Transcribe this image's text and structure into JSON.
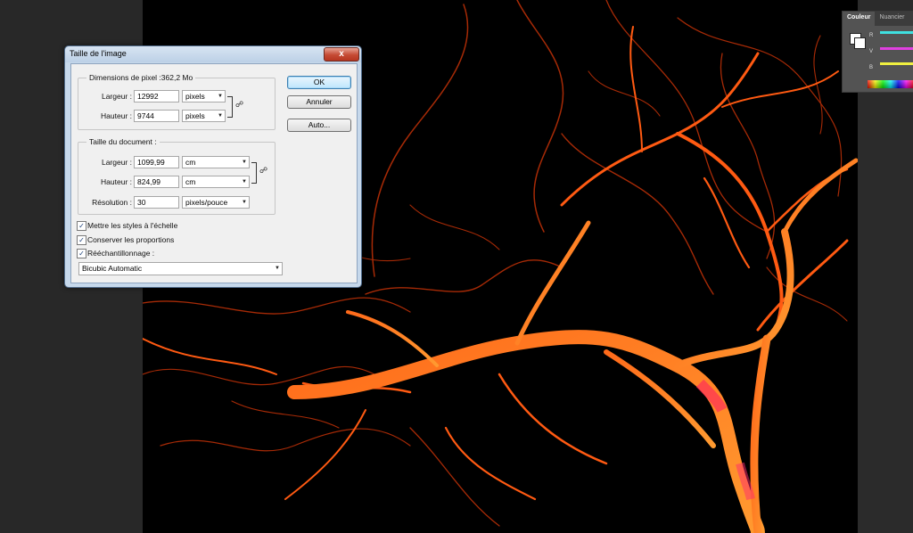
{
  "dialog": {
    "title": "Taille de l'image",
    "close_label": "x",
    "pixel_dimensions": {
      "title": "Dimensions de pixel :362,2 Mo",
      "width_label": "Largeur :",
      "width_value": "12992",
      "width_unit": "pixels",
      "height_label": "Hauteur :",
      "height_value": "9744",
      "height_unit": "pixels"
    },
    "document_size": {
      "title": "Taille du document :",
      "width_label": "Largeur :",
      "width_value": "1099,99",
      "width_unit": "cm",
      "height_label": "Hauteur :",
      "height_value": "824,99",
      "height_unit": "cm",
      "resolution_label": "Résolution :",
      "resolution_value": "30",
      "resolution_unit": "pixels/pouce"
    },
    "buttons": {
      "ok": "OK",
      "cancel": "Annuler",
      "auto": "Auto..."
    },
    "options": {
      "scale_styles": "Mettre les styles à l'échelle",
      "constrain": "Conserver les proportions",
      "resample": "Rééchantillonnage :",
      "scale_styles_checked": true,
      "constrain_checked": true,
      "resample_checked": true
    },
    "resample_method": "Bicubic Automatic"
  },
  "color_panel": {
    "tabs": [
      "Couleur",
      "Nuancier"
    ],
    "channels": [
      {
        "label": "R",
        "color": "#3fe0e0"
      },
      {
        "label": "V",
        "color": "#e040e0"
      },
      {
        "label": "B",
        "color": "#f0f040"
      }
    ]
  },
  "icons": {
    "link": "chain-link-icon",
    "dropdown": "chevron-down-icon",
    "check": "check-icon",
    "close": "close-icon"
  },
  "colors": {
    "canvas_bg": "#000000",
    "vein_color": "#ff4a10",
    "workspace_bg": "#282828"
  }
}
